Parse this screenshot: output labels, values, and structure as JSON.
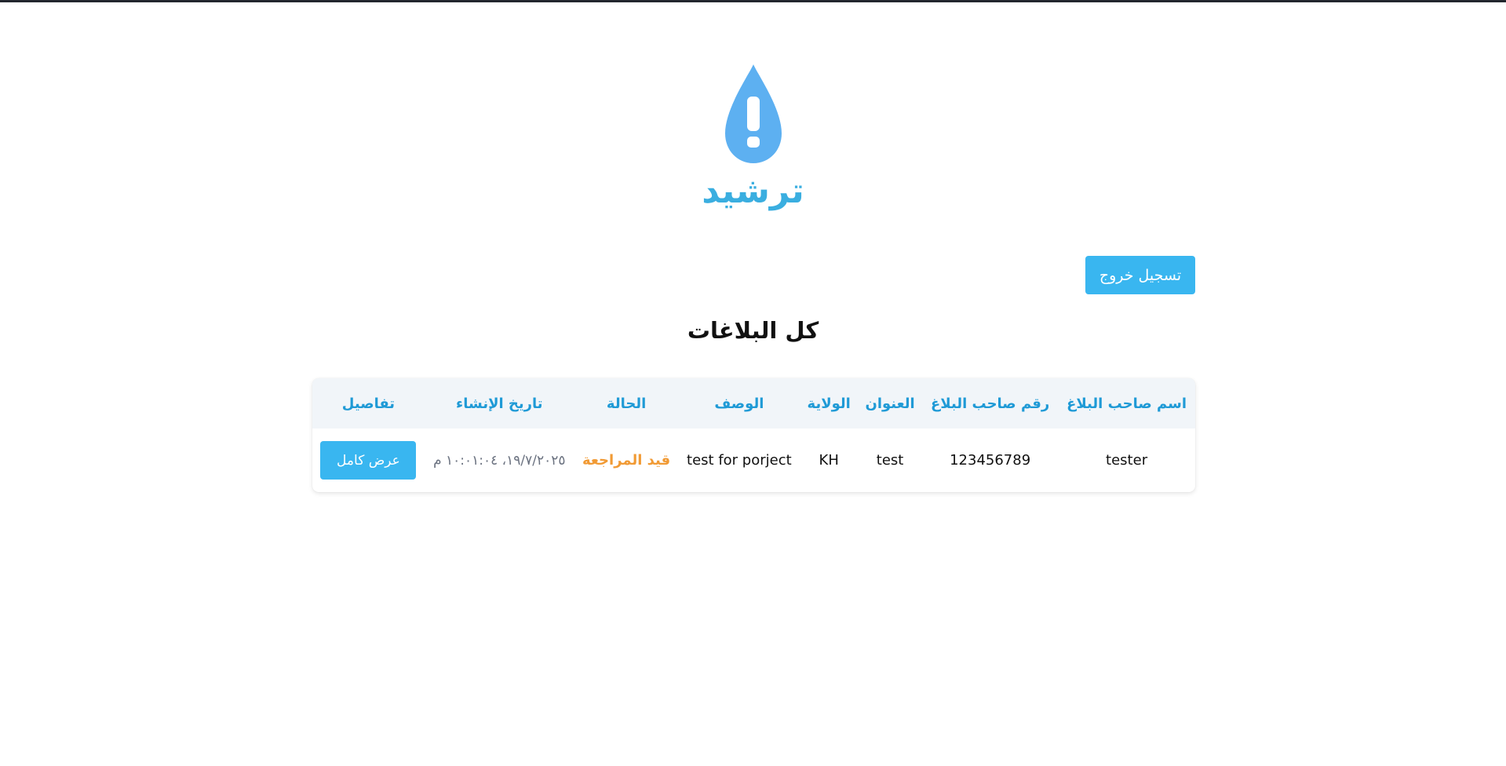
{
  "brand": {
    "name": "ترشيد",
    "icon": "water-drop-exclamation-icon",
    "accent": "#3aaee0",
    "icon_color": "#5db0f1"
  },
  "header": {
    "logout_label": "تسجيل خروج"
  },
  "page": {
    "title": "كل البلاغات"
  },
  "table": {
    "columns": [
      "اسم صاحب البلاغ",
      "رقم صاحب البلاغ",
      "العنوان",
      "الولاية",
      "الوصف",
      "الحالة",
      "تاريخ الإنشاء",
      "تفاصيل"
    ],
    "rows": [
      {
        "name": "tester",
        "phone": "123456789",
        "address": "test",
        "state": "KH",
        "description": "test for porject",
        "status": "قيد المراجعة",
        "created_at": "١٩/٧/٢٠٢٥، ١٠:٠١:٠٤ م",
        "details_label": "عرض كامل"
      }
    ]
  },
  "colors": {
    "button": "#39b6f0",
    "header_text": "#1f9ad6",
    "status_pending": "#f19a34"
  }
}
